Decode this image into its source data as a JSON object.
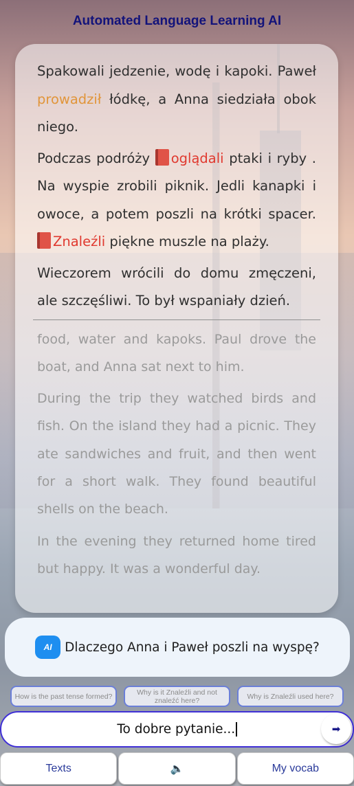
{
  "header": {
    "title": "Automated Language Learning AI"
  },
  "reader": {
    "polish": [
      {
        "segments": [
          {
            "text": "Spakowali jedzenie, wodę i kapoki. Paweł ",
            "style": "plain"
          },
          {
            "text": "prowadził",
            "style": "orange"
          },
          {
            "text": " łódkę, a Anna siedziała obok niego.",
            "style": "plain"
          }
        ]
      },
      {
        "segments": [
          {
            "text": "Podczas podróży ",
            "style": "plain"
          },
          {
            "text": "oglądali",
            "style": "red-book"
          },
          {
            "text": " ptaki i ryby . Na wyspie zrobili piknik. Jedli kanapki i owoce, a potem poszli na krótki spacer. ",
            "style": "plain"
          },
          {
            "text": "Znaleźli",
            "style": "red-book"
          },
          {
            "text": " piękne muszle na plaży.",
            "style": "plain"
          }
        ]
      },
      {
        "segments": [
          {
            "text": "Wieczorem wrócili do domu zmęczeni, ale szczęśliwi. To był wspaniały dzień.",
            "style": "plain"
          }
        ]
      }
    ],
    "english": [
      "food, water and kapoks. Paul drove the boat, and Anna sat next to him.",
      "During the trip they watched birds and fish. On the island they had a picnic. They ate sandwiches and fruit, and then went for a short walk. They found beautiful shells on the beach.",
      "In the evening they returned home tired but happy. It was a wonderful day."
    ],
    "icons": {
      "highlight_marker": "red-book-icon"
    },
    "colors": {
      "orange_word": "#e1953a",
      "red_word": "#e0392f"
    }
  },
  "question": {
    "badge": "AI",
    "text": "Dlaczego Anna i Paweł poszli na wyspę?"
  },
  "suggestions": [
    "How is the past tense formed?",
    "Why is it Znaleźli and not znaleźć here?",
    "Why is Znaleźli used here?"
  ],
  "input": {
    "value": "To dobre pytanie...",
    "send_icon": "send-arrow-icon"
  },
  "bottom_nav": {
    "texts": "Texts",
    "audio_icon": "🔈",
    "vocab": "My vocab"
  },
  "accent_colors": {
    "title": "#13137a",
    "input_border": "#3f2fd6",
    "chip_border": "#6b7fd8",
    "ai_badge": "#1e8ef0"
  }
}
